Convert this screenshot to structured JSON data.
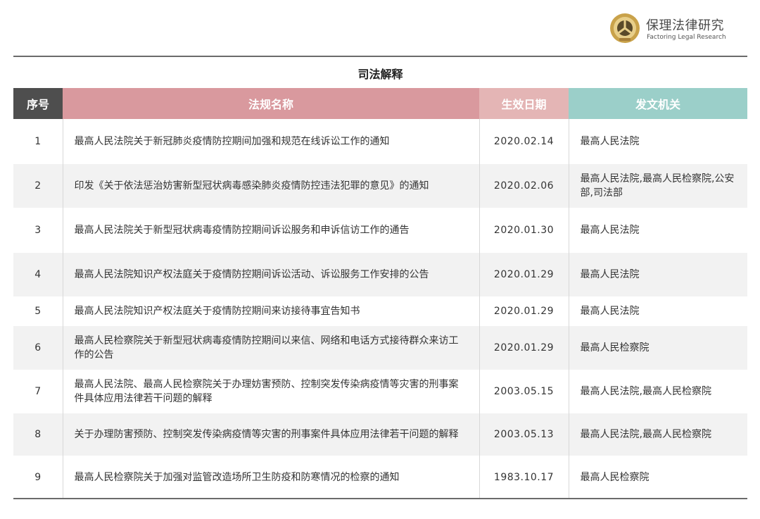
{
  "brand": {
    "name_cn": "保理法律研究",
    "name_en": "Factoring Legal Research"
  },
  "title": "司法解释",
  "headers": {
    "no": "序号",
    "name": "法规名称",
    "date": "生效日期",
    "org": "发文机关"
  },
  "rows": [
    {
      "no": "1",
      "name": "最高人民法院关于新冠肺炎疫情防控期间加强和规范在线诉讼工作的通知",
      "date": "2020.02.14",
      "org": "最高人民法院"
    },
    {
      "no": "2",
      "name": "印发《关于依法惩治妨害新型冠状病毒感染肺炎疫情防控违法犯罪的意见》的通知",
      "date": "2020.02.06",
      "org": "最高人民法院,最高人民检察院,公安部,司法部"
    },
    {
      "no": "3",
      "name": "最高人民法院关于新型冠状病毒疫情防控期间诉讼服务和申诉信访工作的通告",
      "date": "2020.01.30",
      "org": "最高人民法院"
    },
    {
      "no": "4",
      "name": "最高人民法院知识产权法庭关于疫情防控期间诉讼活动、诉讼服务工作安排的公告",
      "date": "2020.01.29",
      "org": "最高人民法院"
    },
    {
      "no": "5",
      "name": "最高人民法院知识产权法庭关于疫情防控期间来访接待事宜告知书",
      "date": "2020.01.29",
      "org": "最高人民法院"
    },
    {
      "no": "6",
      "name": "最高人民检察院关于新型冠状病毒疫情防控期间以来信、网络和电话方式接待群众来访工作的公告",
      "date": "2020.01.29",
      "org": "最高人民检察院"
    },
    {
      "no": "7",
      "name": "最高人民法院、最高人民检察院关于办理妨害预防、控制突发传染病疫情等灾害的刑事案件具体应用法律若干问题的解释",
      "date": "2003.05.15",
      "org": "最高人民法院,最高人民检察院"
    },
    {
      "no": "8",
      "name": "关于办理防害预防、控制突发传染病疫情等灾害的刑事案件具体应用法律若干问题的解释",
      "date": "2003.05.13",
      "org": "最高人民法院,最高人民检察院"
    },
    {
      "no": "9",
      "name": "最高人民检察院关于加强对监管改造场所卫生防疫和防寒情况的检察的通知",
      "date": "1983.10.17",
      "org": "最高人民检察院"
    }
  ],
  "colors": {
    "header_no": "#4e4e4e",
    "header_name": "#d9999e",
    "header_date": "#e4b5b5",
    "header_org": "#9bcfc9",
    "stripe": "#f2f2f2",
    "logo_gold": "#c9a24a"
  }
}
